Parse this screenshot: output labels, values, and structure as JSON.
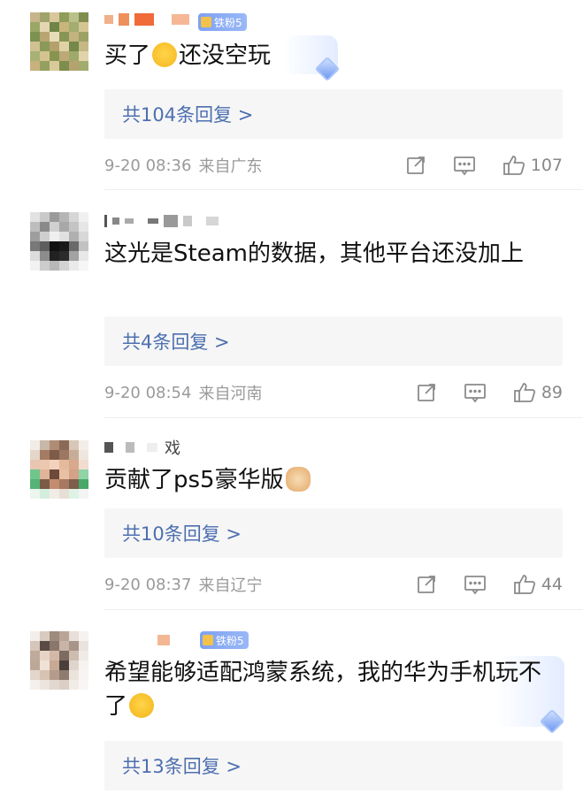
{
  "comments": [
    {
      "badge": "铁粉5",
      "text_before": "买了",
      "text_after": "还没空玩",
      "emoji": "sweat-smile-emoji",
      "replies": "共104条回复 >",
      "time": "9-20 08:36",
      "location": "来自广东",
      "likes": "107"
    },
    {
      "text_before": "这光是Steam的数据，其他平台还没加上",
      "replies": "共4条回复 >",
      "time": "9-20 08:54",
      "location": "来自河南",
      "likes": "89"
    },
    {
      "name_fragment": "戏",
      "text_before": "贡献了ps5豪华版",
      "emoji": "cat-face-emoji",
      "replies": "共10条回复 >",
      "time": "9-20 08:37",
      "location": "来自辽宁",
      "likes": "44"
    },
    {
      "badge": "铁粉5",
      "text_before": "希望能够适配鸿蒙系统，我的华为手机玩不了",
      "emoji": "shushing-face-emoji",
      "replies": "共13条回复 >"
    }
  ],
  "icons": {
    "repost": "repost-icon",
    "comment": "comment-icon",
    "like": "thumbs-up-icon",
    "badge": "fan-badge-icon",
    "diamond": "diamond-decoration-icon"
  },
  "colors": {
    "reply_link": "#4d6fb0",
    "meta": "#9a9a9a",
    "reply_bg": "#f6f6f6",
    "badge": "#8aabf4"
  }
}
